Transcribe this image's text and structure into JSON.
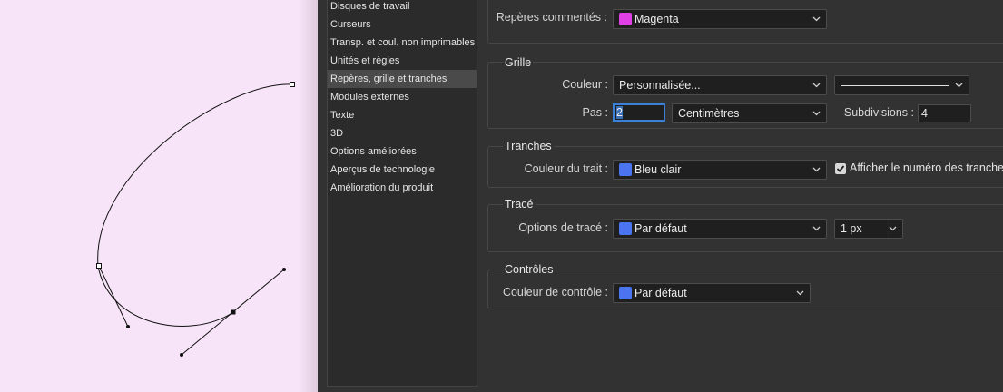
{
  "sidebar": {
    "items": [
      {
        "label": "Disques de travail",
        "selected": false
      },
      {
        "label": "Curseurs",
        "selected": false
      },
      {
        "label": "Transp. et coul. non imprimables",
        "selected": false
      },
      {
        "label": "Unités et règles",
        "selected": false
      },
      {
        "label": "Repères, grille et tranches",
        "selected": true
      },
      {
        "label": "Modules externes",
        "selected": false
      },
      {
        "label": "Texte",
        "selected": false
      },
      {
        "label": "3D",
        "selected": false
      },
      {
        "label": "Options améliorées",
        "selected": false
      },
      {
        "label": "Aperçus de technologie",
        "selected": false
      },
      {
        "label": "Amélioration du produit",
        "selected": false
      }
    ]
  },
  "reperes_commentes": {
    "label": "Repères commentés :",
    "color_value": "Magenta",
    "swatch_color": "#e040e6"
  },
  "grille": {
    "title": "Grille",
    "couleur_label": "Couleur :",
    "couleur_value": "Personnalisée...",
    "line_style": "solid-line",
    "pas_label": "Pas :",
    "pas_value": "2",
    "unit_value": "Centimètres",
    "subdivisions_label": "Subdivisions :",
    "subdivisions_value": "4"
  },
  "tranches": {
    "title": "Tranches",
    "couleur_label": "Couleur du trait :",
    "couleur_value": "Bleu clair",
    "swatch_color": "#4a74f0",
    "show_numbers_label": "Afficher le numéro des tranches",
    "show_numbers_checked": true
  },
  "trace": {
    "title": "Tracé",
    "options_label": "Options de tracé :",
    "options_value": "Par défaut",
    "swatch_color": "#4a74f0",
    "width_value": "1 px"
  },
  "controles": {
    "title": "Contrôles",
    "couleur_label": "Couleur de contrôle :",
    "couleur_value": "Par défaut",
    "swatch_color": "#4a74f0"
  },
  "colors": {
    "canvas_bg": "#f8e4f8",
    "dialog_bg": "#323232",
    "focus_ring": "#3c7fd6"
  }
}
